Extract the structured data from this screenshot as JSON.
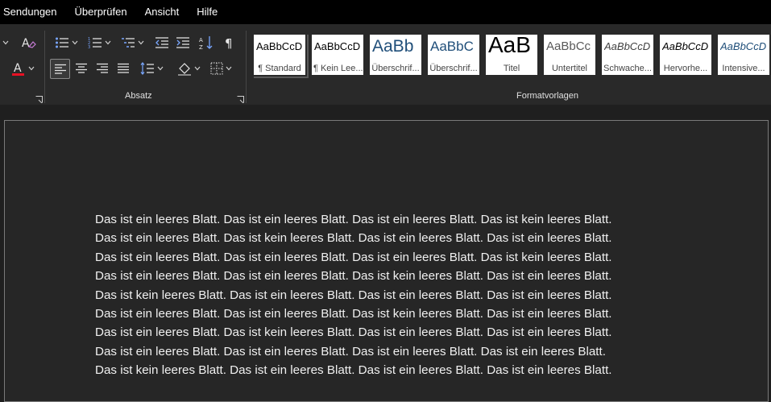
{
  "menu": {
    "items": [
      "Sendungen",
      "Überprüfen",
      "Ansicht",
      "Hilfe"
    ]
  },
  "ribbon": {
    "absatz_label": "Absatz",
    "formatvorlagen_label": "Formatvorlagen",
    "font_color": "#e81123",
    "styles": [
      {
        "sample": "AaBbCcD",
        "name": "¶ Standard",
        "color": "#000000"
      },
      {
        "sample": "AaBbCcD",
        "name": "¶ Kein Lee...",
        "color": "#000000"
      },
      {
        "sample": "AaBb",
        "name": "Überschrif...",
        "color": "#1f4e79"
      },
      {
        "sample": "AaBbC",
        "name": "Überschrif...",
        "color": "#1f4e79"
      },
      {
        "sample": "AaB",
        "name": "Titel",
        "color": "#000000"
      },
      {
        "sample": "AaBbCc",
        "name": "Untertitel",
        "color": "#595959"
      },
      {
        "sample": "AaBbCcD",
        "name": "Schwache...",
        "color": "#404040"
      },
      {
        "sample": "AaBbCcD",
        "name": "Hervorhe...",
        "color": "#000000"
      },
      {
        "sample": "AaBbCcD",
        "name": "Intensive...",
        "color": "#1f4e79"
      }
    ]
  },
  "document": {
    "lines": [
      "Das ist ein leeres Blatt. Das ist ein leeres Blatt. Das ist ein leeres Blatt. Das ist kein leeres Blatt.",
      "Das ist ein leeres Blatt. Das ist kein leeres Blatt. Das ist ein leeres Blatt. Das ist ein leeres Blatt.",
      "Das ist ein leeres Blatt. Das ist ein leeres Blatt. Das ist ein leeres Blatt. Das ist kein leeres Blatt.",
      "Das ist ein leeres Blatt. Das ist ein leeres Blatt. Das ist kein leeres Blatt. Das ist ein leeres Blatt.",
      "Das ist kein leeres Blatt. Das ist ein leeres Blatt. Das ist ein leeres Blatt. Das ist ein leeres Blatt.",
      "Das ist ein leeres Blatt. Das ist ein leeres Blatt. Das ist kein leeres Blatt. Das ist ein leeres Blatt.",
      "Das ist ein leeres Blatt. Das ist kein leeres Blatt. Das ist ein leeres Blatt. Das ist ein leeres Blatt.",
      "Das ist ein leeres Blatt. Das ist ein leeres Blatt. Das ist ein leeres Blatt. Das ist ein leeres Blatt.",
      "Das ist kein leeres Blatt. Das ist ein leeres Blatt. Das ist ein leeres Blatt. Das ist ein leeres Blatt."
    ]
  }
}
